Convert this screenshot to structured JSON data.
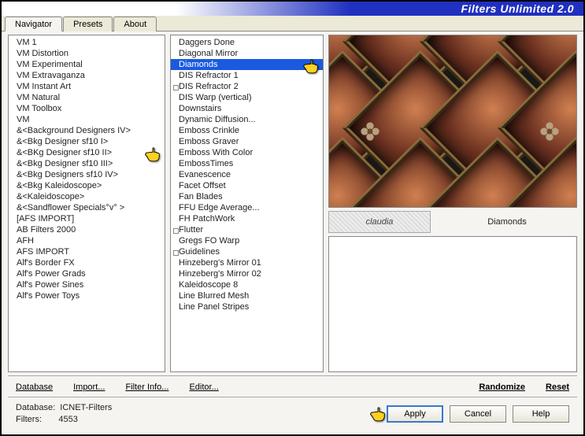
{
  "title": "Filters Unlimited 2.0",
  "tabs": {
    "navigator": "Navigator",
    "presets": "Presets",
    "about": "About"
  },
  "categories": [
    "VM 1",
    "VM Distortion",
    "VM Experimental",
    "VM Extravaganza",
    "VM Instant Art",
    "VM Natural",
    "VM Toolbox",
    "VM",
    "&<Background Designers IV>",
    "&<Bkg Designer sf10 I>",
    "&<BKg Designer sf10 II>",
    "&<Bkg Designer sf10 III>",
    "&<Bkg Designers sf10 IV>",
    "&<Bkg Kaleidoscope>",
    "&<Kaleidoscope>",
    "&<Sandflower Specials°v° >",
    "[AFS IMPORT]",
    "AB Filters 2000",
    "AFH",
    "AFS IMPORT",
    "Alf's Border FX",
    "Alf's Power Grads",
    "Alf's Power Sines",
    "Alf's Power Toys"
  ],
  "categories_selected_index": 10,
  "filters": [
    "Daggers Done",
    "Diagonal Mirror",
    "Diamonds",
    "DIS Refractor 1",
    "DIS Refractor 2",
    "DIS Warp (vertical)",
    "Downstairs",
    "Dynamic Diffusion...",
    "Emboss Crinkle",
    "Emboss Graver",
    "Emboss With Color",
    "EmbossTimes",
    "Evanescence",
    "Facet Offset",
    "Fan Blades",
    "FFU Edge Average...",
    "FH PatchWork",
    "Flutter",
    "Gregs FO Warp",
    "Guidelines",
    "Hinzeberg's Mirror 01",
    "Hinzeberg's Mirror 02",
    "Kaleidoscope 8",
    "Line Blurred Mesh",
    "Line Panel Stripes"
  ],
  "filters_tree_indices": [
    4,
    17,
    19
  ],
  "filters_selected_index": 2,
  "selected_filter_name": "Diamonds",
  "watermark_text": "claudia",
  "links": {
    "database": "Database",
    "import": "Import...",
    "filter_info": "Filter Info...",
    "editor": "Editor...",
    "randomize": "Randomize",
    "reset": "Reset"
  },
  "status": {
    "database_label": "Database:",
    "database_value": "ICNET-Filters",
    "filters_label": "Filters:",
    "filters_value": "4553"
  },
  "buttons": {
    "apply": "Apply",
    "cancel": "Cancel",
    "help": "Help"
  },
  "colors": {
    "selection": "#1a5ae0",
    "titlebar_blue": "#2030c0"
  },
  "annotations": {
    "hand_on_category": true,
    "hand_on_filter": true,
    "hand_on_apply": true
  }
}
